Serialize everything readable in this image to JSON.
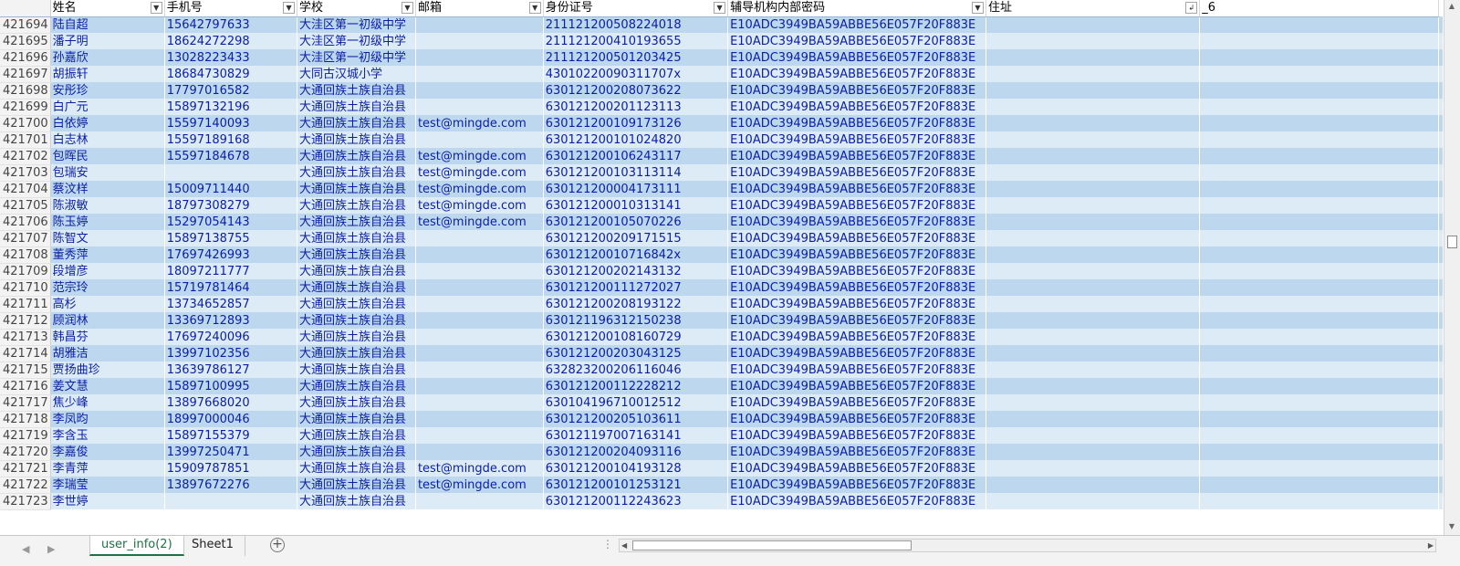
{
  "headers": [
    "姓名",
    "手机号",
    "学校",
    "邮箱",
    "身份证号",
    "辅导机构内部密码",
    "住址",
    "_6"
  ],
  "rows": [
    {
      "n": "421694",
      "c": [
        "陆自超",
        "15642797633",
        "大洼区第一初级中学",
        "",
        "211121200508224018",
        "E10ADC3949BA59ABBE56E057F20F883E",
        "",
        ""
      ]
    },
    {
      "n": "421695",
      "c": [
        "潘子明",
        "18624272298",
        "大洼区第一初级中学",
        "",
        "211121200410193655",
        "E10ADC3949BA59ABBE56E057F20F883E",
        "",
        ""
      ]
    },
    {
      "n": "421696",
      "c": [
        "孙嘉欣",
        "13028223433",
        "大洼区第一初级中学",
        "",
        "211121200501203425",
        "E10ADC3949BA59ABBE56E057F20F883E",
        "",
        ""
      ]
    },
    {
      "n": "421697",
      "c": [
        "胡振轩",
        "18684730829",
        "大同古汉城小学",
        "",
        "43010220090311707x",
        "E10ADC3949BA59ABBE56E057F20F883E",
        "",
        ""
      ]
    },
    {
      "n": "421698",
      "c": [
        "安彤珍",
        "17797016582",
        "大通回族土族自治县",
        "",
        "630121200208073622",
        "E10ADC3949BA59ABBE56E057F20F883E",
        "",
        ""
      ]
    },
    {
      "n": "421699",
      "c": [
        "白广元",
        "15897132196",
        "大通回族土族自治县",
        "",
        "630121200201123113",
        "E10ADC3949BA59ABBE56E057F20F883E",
        "",
        ""
      ]
    },
    {
      "n": "421700",
      "c": [
        "白依婷",
        "15597140093",
        "大通回族土族自治县",
        "test@mingde.com",
        "630121200109173126",
        "E10ADC3949BA59ABBE56E057F20F883E",
        "",
        ""
      ]
    },
    {
      "n": "421701",
      "c": [
        "白志林",
        "15597189168",
        "大通回族土族自治县",
        "",
        "630121200101024820",
        "E10ADC3949BA59ABBE56E057F20F883E",
        "",
        ""
      ]
    },
    {
      "n": "421702",
      "c": [
        "包晖民",
        "15597184678",
        "大通回族土族自治县",
        "test@mingde.com",
        "630121200106243117",
        "E10ADC3949BA59ABBE56E057F20F883E",
        "",
        ""
      ]
    },
    {
      "n": "421703",
      "c": [
        "包瑞安",
        "",
        "大通回族土族自治县",
        "test@mingde.com",
        "630121200103113114",
        "E10ADC3949BA59ABBE56E057F20F883E",
        "",
        ""
      ]
    },
    {
      "n": "421704",
      "c": [
        "蔡汶样",
        "15009711440",
        "大通回族土族自治县",
        "test@mingde.com",
        "630121200004173111",
        "E10ADC3949BA59ABBE56E057F20F883E",
        "",
        ""
      ]
    },
    {
      "n": "421705",
      "c": [
        "陈淑敏",
        "18797308279",
        "大通回族土族自治县",
        "test@mingde.com",
        "630121200010313141",
        "E10ADC3949BA59ABBE56E057F20F883E",
        "",
        ""
      ]
    },
    {
      "n": "421706",
      "c": [
        "陈玉婷",
        "15297054143",
        "大通回族土族自治县",
        "test@mingde.com",
        "630121200105070226",
        "E10ADC3949BA59ABBE56E057F20F883E",
        "",
        ""
      ]
    },
    {
      "n": "421707",
      "c": [
        "陈智文",
        "15897138755",
        "大通回族土族自治县",
        "",
        "630121200209171515",
        "E10ADC3949BA59ABBE56E057F20F883E",
        "",
        ""
      ]
    },
    {
      "n": "421708",
      "c": [
        "董秀萍",
        "17697426993",
        "大通回族土族自治县",
        "",
        "63012120010716842x",
        "E10ADC3949BA59ABBE56E057F20F883E",
        "",
        ""
      ]
    },
    {
      "n": "421709",
      "c": [
        "段增彦",
        "18097211777",
        "大通回族土族自治县",
        "",
        "630121200202143132",
        "E10ADC3949BA59ABBE56E057F20F883E",
        "",
        ""
      ]
    },
    {
      "n": "421710",
      "c": [
        "范宗玲",
        "15719781464",
        "大通回族土族自治县",
        "",
        "630121200111272027",
        "E10ADC3949BA59ABBE56E057F20F883E",
        "",
        ""
      ]
    },
    {
      "n": "421711",
      "c": [
        "高杉",
        "13734652857",
        "大通回族土族自治县",
        "",
        "630121200208193122",
        "E10ADC3949BA59ABBE56E057F20F883E",
        "",
        ""
      ]
    },
    {
      "n": "421712",
      "c": [
        "顾润林",
        "13369712893",
        "大通回族土族自治县",
        "",
        "630121196312150238",
        "E10ADC3949BA59ABBE56E057F20F883E",
        "",
        ""
      ]
    },
    {
      "n": "421713",
      "c": [
        "韩昌芬",
        "17697240096",
        "大通回族土族自治县",
        "",
        "630121200108160729",
        "E10ADC3949BA59ABBE56E057F20F883E",
        "",
        ""
      ]
    },
    {
      "n": "421714",
      "c": [
        "胡雅洁",
        "13997102356",
        "大通回族土族自治县",
        "",
        "630121200203043125",
        "E10ADC3949BA59ABBE56E057F20F883E",
        "",
        ""
      ]
    },
    {
      "n": "421715",
      "c": [
        "贾扬曲珍",
        "13639786127",
        "大通回族土族自治县",
        "",
        "632823200206116046",
        "E10ADC3949BA59ABBE56E057F20F883E",
        "",
        ""
      ]
    },
    {
      "n": "421716",
      "c": [
        "姜文慧",
        "15897100995",
        "大通回族土族自治县",
        "",
        "630121200112228212",
        "E10ADC3949BA59ABBE56E057F20F883E",
        "",
        ""
      ]
    },
    {
      "n": "421717",
      "c": [
        "焦少峰",
        "13897668020",
        "大通回族土族自治县",
        "",
        "630104196710012512",
        "E10ADC3949BA59ABBE56E057F20F883E",
        "",
        ""
      ]
    },
    {
      "n": "421718",
      "c": [
        "李凤昀",
        "18997000046",
        "大通回族土族自治县",
        "",
        "630121200205103611",
        "E10ADC3949BA59ABBE56E057F20F883E",
        "",
        ""
      ]
    },
    {
      "n": "421719",
      "c": [
        "李含玉",
        "15897155379",
        "大通回族土族自治县",
        "",
        "630121197007163141",
        "E10ADC3949BA59ABBE56E057F20F883E",
        "",
        ""
      ]
    },
    {
      "n": "421720",
      "c": [
        "李嘉俊",
        "13997250471",
        "大通回族土族自治县",
        "",
        "630121200204093116",
        "E10ADC3949BA59ABBE56E057F20F883E",
        "",
        ""
      ]
    },
    {
      "n": "421721",
      "c": [
        "李青萍",
        "15909787851",
        "大通回族土族自治县",
        "test@mingde.com",
        "630121200104193128",
        "E10ADC3949BA59ABBE56E057F20F883E",
        "",
        ""
      ]
    },
    {
      "n": "421722",
      "c": [
        "李瑞莹",
        "13897672276",
        "大通回族土族自治县",
        "test@mingde.com",
        "630121200101253121",
        "E10ADC3949BA59ABBE56E057F20F883E",
        "",
        ""
      ]
    },
    {
      "n": "421723",
      "c": [
        "李世婷",
        "",
        "大通回族土族自治县",
        "",
        "630121200112243623",
        "E10ADC3949BA59ABBE56E057F20F883E",
        "",
        ""
      ]
    }
  ],
  "tabs": {
    "active": "user_info(2)",
    "other": "Sheet1"
  },
  "icons": {
    "filter": "filter-dropdown-icon",
    "sort_filter": "sort-filter-icon",
    "add": "add-sheet-icon"
  },
  "colors": {
    "row_dark": "#bdd7ee",
    "row_light": "#ddebf7",
    "text": "#0a1ea6",
    "tab_active": "#1e7145"
  }
}
